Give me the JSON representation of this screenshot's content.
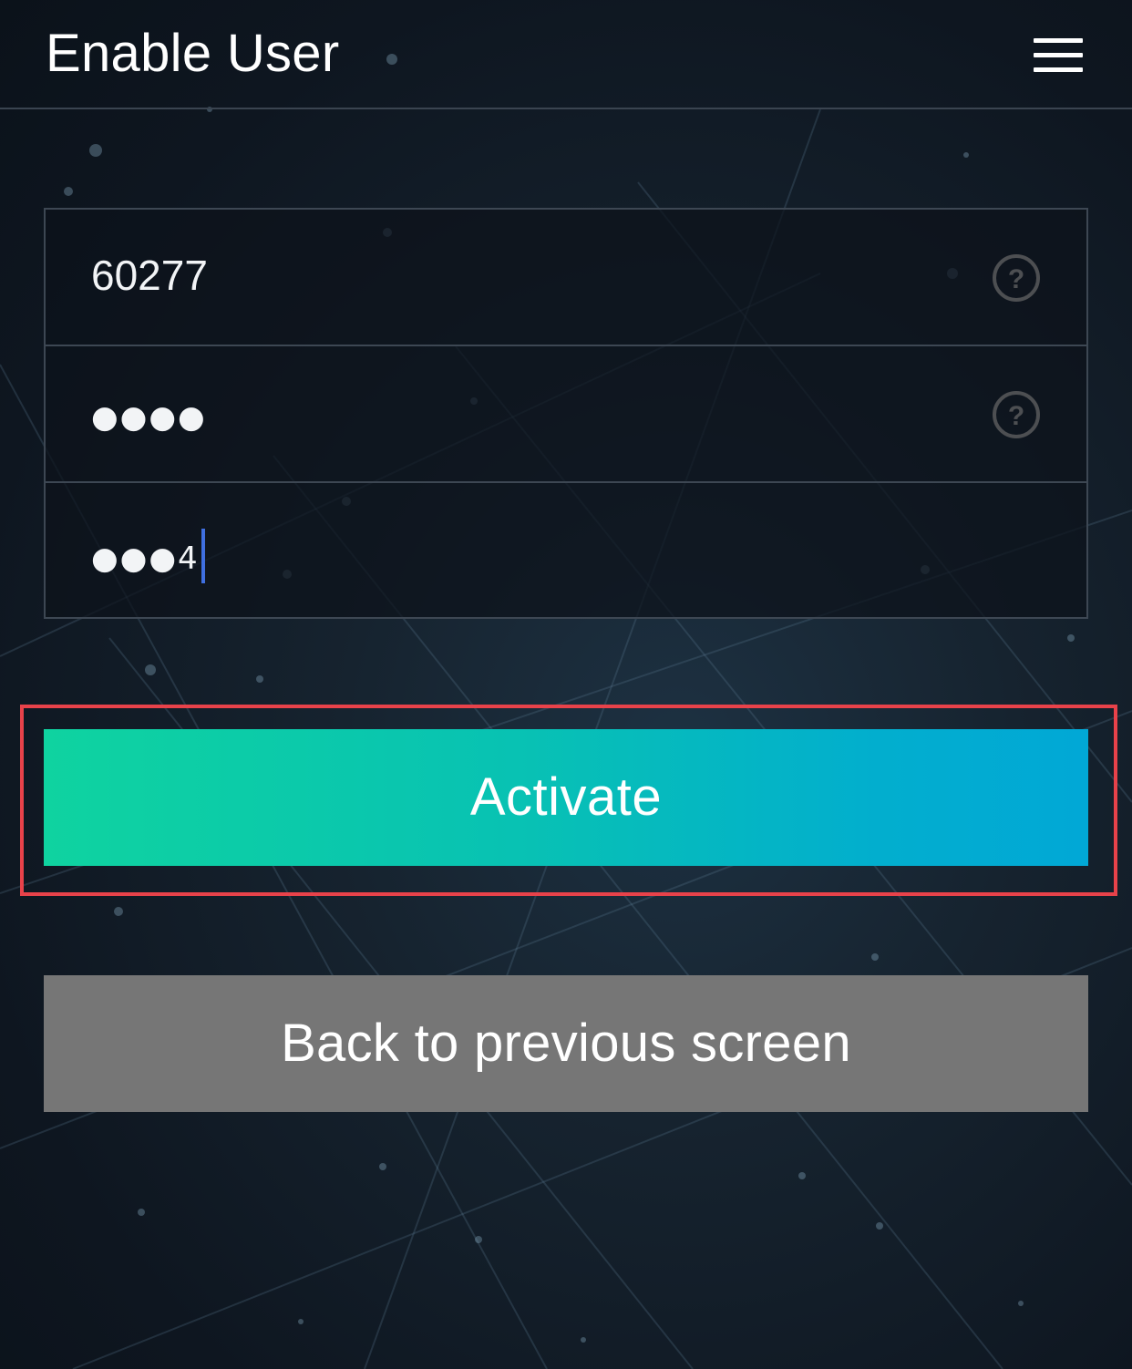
{
  "header": {
    "title": "Enable User",
    "menu_icon": "hamburger-menu-icon"
  },
  "form": {
    "fields": [
      {
        "value": "60277",
        "help_icon": "question-circle-icon"
      },
      {
        "value": "●●●●",
        "help_icon": "question-circle-icon"
      },
      {
        "value": "●●●4"
      }
    ]
  },
  "buttons": {
    "activate_label": "Activate",
    "back_label": "Back to previous screen"
  },
  "colors": {
    "activate_gradient_start": "#0fd3a0",
    "activate_gradient_end": "#01a8d6",
    "back_button": "#767676",
    "highlight": "#e8424a",
    "caret": "#3f6fe0"
  }
}
